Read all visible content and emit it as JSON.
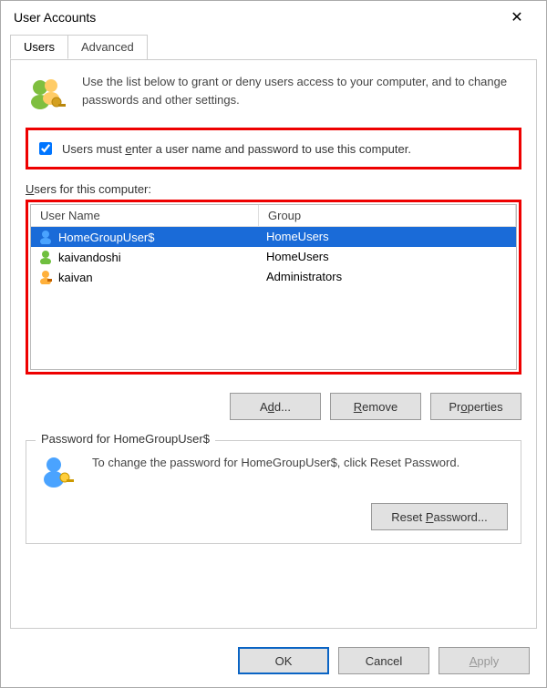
{
  "window": {
    "title": "User Accounts"
  },
  "tabs": {
    "users": "Users",
    "advanced": "Advanced"
  },
  "intro": "Use the list below to grant or deny users access to your computer, and to change passwords and other settings.",
  "checkbox": {
    "label_pre": "Users must ",
    "label_u": "e",
    "label_post": "nter a user name and password to use this computer.",
    "checked": true
  },
  "users_label_pre": "",
  "users_label_u": "U",
  "users_label_post": "sers for this computer:",
  "columns": {
    "user": "User Name",
    "group": "Group"
  },
  "users": [
    {
      "name": "HomeGroupUser$",
      "group": "HomeUsers",
      "selected": true
    },
    {
      "name": "kaivandoshi",
      "group": "HomeUsers",
      "selected": false
    },
    {
      "name": "kaivan",
      "group": "Administrators",
      "selected": false
    }
  ],
  "buttons": {
    "add_pre": "A",
    "add_u": "d",
    "add_post": "d...",
    "remove_pre": "",
    "remove_u": "R",
    "remove_post": "emove",
    "props_pre": "Pr",
    "props_u": "o",
    "props_post": "perties",
    "reset_pre": "Reset ",
    "reset_u": "P",
    "reset_post": "assword...",
    "ok": "OK",
    "cancel": "Cancel",
    "apply_pre": "",
    "apply_u": "A",
    "apply_post": "pply"
  },
  "password_section": {
    "legend": "Password for HomeGroupUser$",
    "text": "To change the password for HomeGroupUser$, click Reset Password."
  }
}
